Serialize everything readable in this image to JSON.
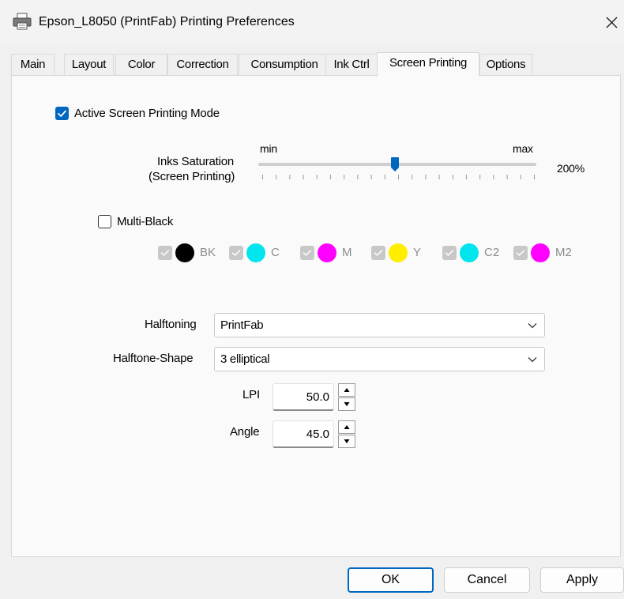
{
  "window": {
    "title": "Epson_L8050 (PrintFab) Printing Preferences",
    "icon": "printer-icon",
    "close_glyph": "✕"
  },
  "tabs": [
    {
      "label": "Main",
      "active": false
    },
    {
      "label": "Layout",
      "active": false
    },
    {
      "label": "Color",
      "active": false
    },
    {
      "label": "Correction",
      "active": false
    },
    {
      "label": "Consumption",
      "active": false
    },
    {
      "label": "Ink Ctrl",
      "active": false
    },
    {
      "label": "Screen Printing",
      "active": true
    },
    {
      "label": "Options",
      "active": false
    }
  ],
  "screen_printing": {
    "active_mode": {
      "label": "Active Screen Printing Mode",
      "checked": true
    },
    "saturation": {
      "label_line1": "Inks Saturation",
      "label_line2": "(Screen Printing)",
      "min_label": "min",
      "max_label": "max",
      "value_text": "200%",
      "level_fraction": 0.5
    },
    "multi_black": {
      "label": "Multi-Black",
      "checked": false
    },
    "inks": [
      {
        "label": "BK",
        "color": "#000000",
        "enabled": false
      },
      {
        "label": "C",
        "color": "#00e5ee",
        "enabled": false
      },
      {
        "label": "M",
        "color": "#ff00ff",
        "enabled": false
      },
      {
        "label": "Y",
        "color": "#ffee00",
        "enabled": false
      },
      {
        "label": "C2",
        "color": "#00e5ee",
        "enabled": false
      },
      {
        "label": "M2",
        "color": "#ff00ff",
        "enabled": false
      }
    ],
    "halftoning": {
      "label": "Halftoning",
      "value": "PrintFab"
    },
    "halftone_shape": {
      "label": "Halftone-Shape",
      "value": "3 elliptical"
    },
    "lpi": {
      "label": "LPI",
      "value": "50.0"
    },
    "angle": {
      "label": "Angle",
      "value": "45.0"
    }
  },
  "buttons": {
    "ok": "OK",
    "cancel": "Cancel",
    "apply": "Apply"
  },
  "colors": {
    "accent": "#0067c0"
  }
}
